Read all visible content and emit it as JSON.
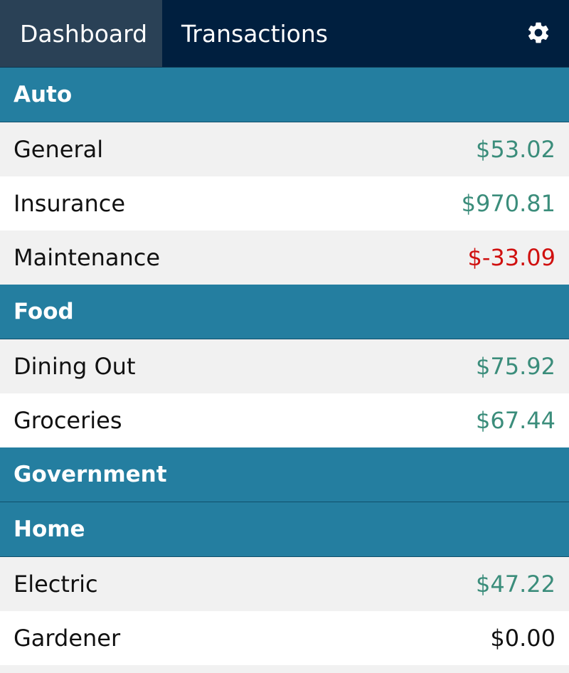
{
  "nav": {
    "tabs": [
      {
        "label": "Dashboard",
        "active": true
      },
      {
        "label": "Transactions",
        "active": false
      }
    ],
    "settings_icon": "gear-icon"
  },
  "colors": {
    "nav_bg": "#001f3f",
    "active_tab_bg": "#2a4156",
    "group_header_bg": "#247ea0",
    "positive_amount": "#3b8d7b",
    "negative_amount": "#d0100f"
  },
  "groups": [
    {
      "name": "Auto",
      "items": [
        {
          "name": "General",
          "amount": "$53.02",
          "sign": "positive"
        },
        {
          "name": "Insurance",
          "amount": "$970.81",
          "sign": "positive"
        },
        {
          "name": "Maintenance",
          "amount": "$-33.09",
          "sign": "negative"
        }
      ]
    },
    {
      "name": "Food",
      "items": [
        {
          "name": "Dining Out",
          "amount": "$75.92",
          "sign": "positive"
        },
        {
          "name": "Groceries",
          "amount": "$67.44",
          "sign": "positive"
        }
      ]
    },
    {
      "name": "Government",
      "items": []
    },
    {
      "name": "Home",
      "items": [
        {
          "name": "Electric",
          "amount": "$47.22",
          "sign": "positive"
        },
        {
          "name": "Gardener",
          "amount": "$0.00",
          "sign": "zero"
        }
      ]
    }
  ]
}
